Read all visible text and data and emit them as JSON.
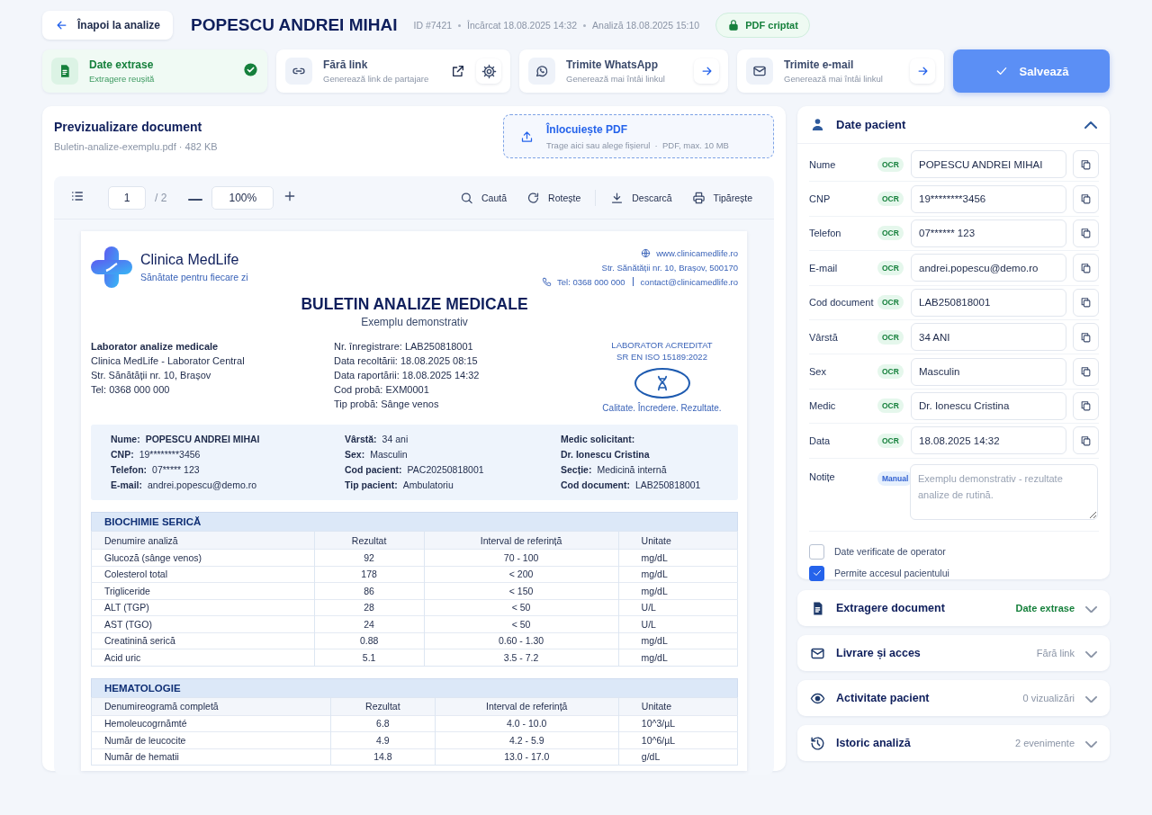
{
  "header": {
    "back_label": "Înapoi la analize",
    "title": "POPESCU ANDREI MIHAI",
    "meta": [
      "ID #7421",
      "Încărcat 18.08.2025 14:32",
      "Analiză 18.08.2025 15:10"
    ],
    "badge": "PDF criptat"
  },
  "actions": [
    {
      "kind": "status",
      "title": "Date extrase",
      "subtitle": "Extragere reușită"
    },
    {
      "kind": "link",
      "title": "Fără link",
      "subtitle": "Generează link de partajare"
    },
    {
      "kind": "whatsapp",
      "title": "Trimite WhatsApp",
      "subtitle": "Generează mai întâi linkul"
    },
    {
      "kind": "email",
      "title": "Trimite e-mail",
      "subtitle": "Generează mai întâi linkul"
    }
  ],
  "save_button": "Salvează",
  "preview": {
    "title": "Previzualizare document",
    "file": "Buletin-analize-exemplu.pdf · 482 KB",
    "upload": {
      "title": "Înlocuiește PDF",
      "hint": "Trage aici sau alege fișierul  ·  PDF, max. 10 MB"
    },
    "toolbar": {
      "page": "1",
      "pages": "/ 2",
      "zoom": "100%",
      "tools": [
        {
          "kind": "search",
          "label": "Caută"
        },
        {
          "kind": "rotate",
          "label": "Rotește"
        },
        {
          "kind": "download",
          "label": "Descarcă"
        },
        {
          "kind": "print",
          "label": "Tipărește"
        }
      ]
    },
    "document": {
      "clinic": {
        "name": "Clinica MedLife",
        "tagline": "Sănătate pentru fiecare zi",
        "website": "www.clinicamedlife.ro",
        "address": "Str. Sănătății nr. 10, Brașov, 500170",
        "phone": "Tel: 0368 000 000",
        "email": "contact@clinicamedlife.ro"
      },
      "title": "BULETIN ANALIZE MEDICALE",
      "subtitle": "Exemplu demonstrativ",
      "lab": [
        "Laborator analize medicale",
        "Clinica MedLife - Laborator Central",
        "Str. Sănătății nr. 10, Brașov",
        "Tel: 0368 000 000"
      ],
      "info": [
        {
          "label": "Nr. înregistrare:",
          "value": "LAB250818001"
        },
        {
          "label": "Data recoltării:",
          "value": "18.08.2025 08:15"
        },
        {
          "label": "Data raportării:",
          "value": "18.08.2025 14:32"
        },
        {
          "label": "Cod probă:",
          "value": "EXM0001"
        },
        {
          "label": "Tip probă:",
          "value": "Sânge venos"
        }
      ],
      "accreditation": {
        "title": "LABORATOR ACREDITAT",
        "standard": "SR EN ISO 15189:2022",
        "motto": "Calitate. Încredere. Rezultate."
      },
      "patient": [
        [
          {
            "label": "Nume:",
            "value": "POPESCU ANDREI MIHAI",
            "stacked": false,
            "bold": true
          },
          {
            "label": "CNP:",
            "value": "19********3456",
            "stacked": false,
            "bold": false
          },
          {
            "label": "Telefon:",
            "value": "07***** 123",
            "stacked": false,
            "bold": false
          },
          {
            "label": "E-mail:",
            "value": "andrei.popescu@demo.ro",
            "stacked": false,
            "bold": false
          }
        ],
        [
          {
            "label": "Vârstă:",
            "value": "34 ani",
            "stacked": false,
            "bold": false
          },
          {
            "label": "Sex:",
            "value": "Masculin",
            "stacked": false,
            "bold": false
          },
          {
            "label": "Cod pacient:",
            "value": "PAC20250818001",
            "stacked": false,
            "bold": false
          },
          {
            "label": "Tip pacient:",
            "value": "Ambulatoriu",
            "stacked": false,
            "bold": false
          }
        ],
        [
          {
            "label": "Medic solicitant:",
            "value": "Dr. Ionescu Cristina",
            "stacked": true,
            "bold": true
          },
          {
            "label": "Secție:",
            "value": "Medicină internă",
            "stacked": false,
            "bold": false
          },
          {
            "label": "Cod document:",
            "value": "LAB250818001",
            "stacked": false,
            "bold": false
          }
        ]
      ],
      "tables": [
        {
          "title": "BIOCHIMIE SERICĂ",
          "columns": [
            "Denumire analiză",
            "Rezultat",
            "Interval de referință",
            "Unitate"
          ],
          "rows": [
            [
              "Glucoză (sânge venos)",
              "92",
              "70 - 100",
              "mg/dL"
            ],
            [
              "Colesterol total",
              "178",
              "< 200",
              "mg/dL"
            ],
            [
              "Trigliceride",
              "86",
              "< 150",
              "mg/dL"
            ],
            [
              "ALT (TGP)",
              "28",
              "< 50",
              "U/L"
            ],
            [
              "AST (TGO)",
              "24",
              "< 50",
              "U/L"
            ],
            [
              "Creatinină serică",
              "0.88",
              "0.60 - 1.30",
              "mg/dL"
            ],
            [
              "Acid uric",
              "5.1",
              "3.5 - 7.2",
              "mg/dL"
            ]
          ]
        },
        {
          "title": "HEMATOLOGIE",
          "columns": [
            "Denumireogramă completă",
            "Rezultat",
            "Interval de referință",
            "Unitate"
          ],
          "rows": [
            [
              "Hemoleucogrnămté",
              "6.8",
              "4.0 - 10.0",
              "10^3/µL"
            ],
            [
              "Număr de leucocite",
              "4.9",
              "4.2 - 5.9",
              "10^6/µL"
            ],
            [
              "Număr de hematii",
              "14.8",
              "13.0 - 17.0",
              "g/dL"
            ]
          ]
        }
      ]
    }
  },
  "patient_panel": {
    "title": "Date pacient",
    "expanded": true,
    "fields": [
      {
        "label": "Nume",
        "kind": "ocr",
        "badge": "OCR",
        "value": "POPESCU ANDREI MIHAI"
      },
      {
        "label": "CNP",
        "kind": "ocr",
        "badge": "OCR",
        "value": "19********3456"
      },
      {
        "label": "Telefon",
        "kind": "ocr",
        "badge": "OCR",
        "value": "07****** 123"
      },
      {
        "label": "E-mail",
        "kind": "ocr",
        "badge": "OCR",
        "value": "andrei.popescu@demo.ro"
      },
      {
        "label": "Cod document",
        "kind": "ocr",
        "badge": "OCR",
        "value": "LAB250818001"
      },
      {
        "label": "Vârstă",
        "kind": "ocr",
        "badge": "OCR",
        "value": "34 ANI"
      },
      {
        "label": "Sex",
        "kind": "ocr",
        "badge": "OCR",
        "value": "Masculin"
      },
      {
        "label": "Medic",
        "kind": "ocr",
        "badge": "OCR",
        "value": "Dr. Ionescu Cristina"
      },
      {
        "label": "Data",
        "kind": "ocr",
        "badge": "OCR",
        "value": "18.08.2025 14:32"
      }
    ],
    "notes": {
      "label": "Notițe",
      "kind": "manual",
      "badge": "Manual",
      "placeholder": "Exemplu demonstrativ - rezultate analize de rutină."
    },
    "checkboxes": [
      {
        "label": "Date verificate de operator",
        "checked": false
      },
      {
        "label": "Permite accesul pacientului",
        "checked": true
      }
    ]
  },
  "sections": [
    {
      "kind": "extract",
      "title": "Extragere document",
      "status": "Date extrase",
      "color": "#16803c",
      "expanded": false
    },
    {
      "kind": "delivery",
      "title": "Livrare și acces",
      "status": "Fără link",
      "color": "#8a94a6",
      "expanded": false
    },
    {
      "kind": "activity",
      "title": "Activitate pacient",
      "status": "0 vizualizări",
      "color": "#8a94a6",
      "expanded": false
    },
    {
      "kind": "history",
      "title": "Istoric analiză",
      "status": "2 evenimente",
      "color": "#8a94a6",
      "expanded": false
    }
  ]
}
